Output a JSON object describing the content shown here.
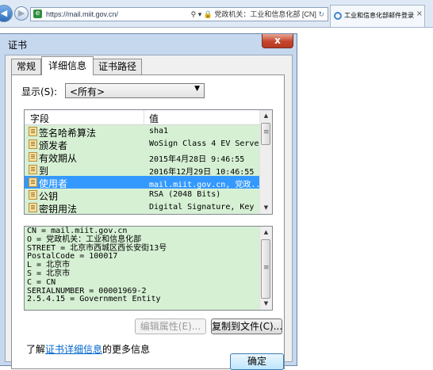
{
  "browser": {
    "url": "https://mail.miit.gov.cn/",
    "address_right": "⚲ ▾ 🔒 党政机关：工业和信息化部 [CN]",
    "refresh_icon": "refresh-icon",
    "tab_title": "工业和信息化部邮件登录",
    "tab_close": "×"
  },
  "dialog": {
    "title": "证书",
    "close_label": "x",
    "tabs": [
      "常规",
      "详细信息",
      "证书路径"
    ],
    "active_tab": 1,
    "show_label": "显示(S):",
    "show_value": "<所有>",
    "columns": {
      "field": "字段",
      "value": "值"
    },
    "rows": [
      {
        "field": "签名哈希算法",
        "value": "sha1"
      },
      {
        "field": "颁发者",
        "value": "WoSign Class 4 EV Serve..."
      },
      {
        "field": "有效期从",
        "value": "2015年4月28日 9:46:55"
      },
      {
        "field": "到",
        "value": "2016年12月29日 10:46:55"
      },
      {
        "field": "使用者",
        "value": "mail.miit.gov.cn, 党政...",
        "selected": true
      },
      {
        "field": "公钥",
        "value": "RSA (2048 Bits)"
      },
      {
        "field": "密钥用法",
        "value": "Digital Signature, Key ..."
      }
    ],
    "detail_lines": [
      "CN = mail.miit.gov.cn",
      "O = 党政机关：工业和信息化部",
      "STREET = 北京市西城区西长安街13号",
      "PostalCode = 100017",
      "L = 北京市",
      "S = 北京市",
      "C = CN",
      "SERIALNUMBER = 00001969-2",
      "2.5.4.15 = Government Entity"
    ],
    "edit_props_label": "编辑属性(E)...",
    "copy_file_label": "复制到文件(C)...",
    "learn_prefix": "了解",
    "learn_link": "证书详细信息",
    "learn_suffix": "的更多信息",
    "ok_label": "确定"
  },
  "colors": {
    "selection": "#3399ff",
    "highlight_green": "#d6f0d4",
    "close_red": "#c4452c",
    "link": "#0066cc"
  }
}
